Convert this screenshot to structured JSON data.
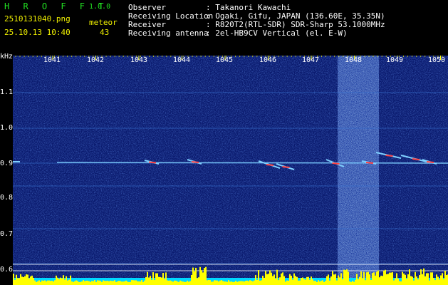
{
  "header": {
    "logo": "H R O F F T",
    "version": "1.0.0",
    "filename": "2510131040.png",
    "timestamp": "25.10.13 10:40",
    "meteor_label": "meteor",
    "meteor_count": "43",
    "info_labels": [
      "Observer",
      "Receiving Location",
      "Receiver",
      "Receiving antenna"
    ],
    "info_values": [
      ": Takanori Kawachi",
      ": Ogaki, Gifu, JAPAN (136.60E, 35.35N)",
      ": R820T2(RTL-SDR) SDR-Sharp 53.1000MHz",
      ": 2el-HB9CV Vertical (el. E-W)"
    ]
  },
  "chart_data": {
    "type": "heatmap",
    "ylabel": "kHz",
    "y_ticks": [
      "1.1",
      "1.0",
      "0.9",
      "0.8",
      "0.7",
      "0.6"
    ],
    "x_ticks": [
      "1041",
      "1042",
      "1043",
      "1044",
      "1045",
      "1046",
      "1047",
      "1048",
      "1049",
      "1050"
    ],
    "colors": {
      "background": "#0a1a6e",
      "carrier": "#7fd0ff",
      "meteor": "#ff4040",
      "bottom_band": "#00d8ff",
      "signal_bars": "#ffff00"
    }
  }
}
